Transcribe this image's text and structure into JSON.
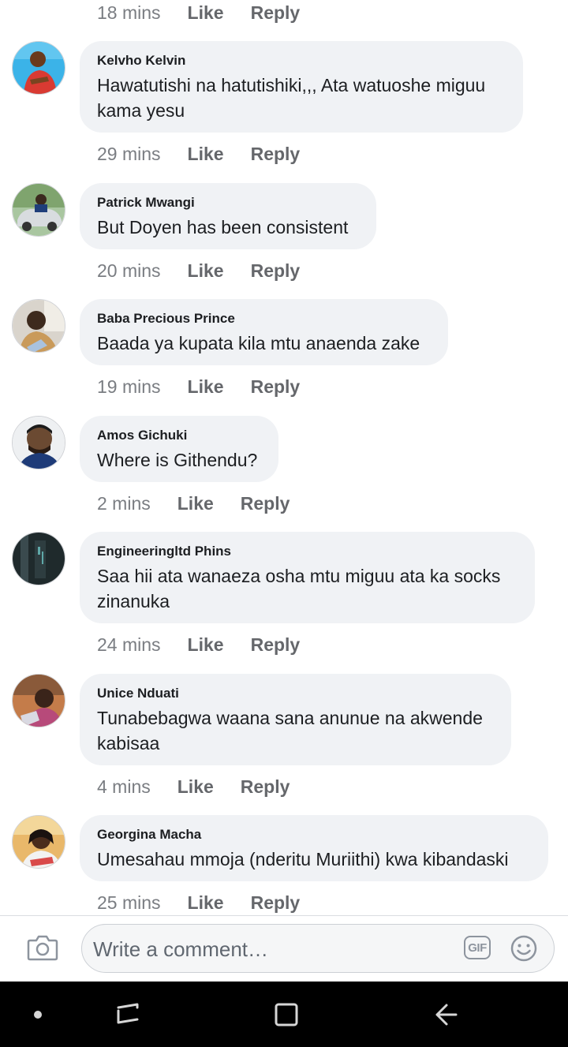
{
  "top_meta": {
    "time": "18 mins",
    "like": "Like",
    "reply": "Reply"
  },
  "comments": [
    {
      "author": "Kelvho Kelvin",
      "text": "Hawatutishi na hatutishiki,,, Ata watuoshe miguu kama yesu",
      "time": "29 mins",
      "like": "Like",
      "reply": "Reply",
      "avatar": "avatar-photo-red-shirt"
    },
    {
      "author": "Patrick Mwangi",
      "text": "But Doyen has been consistent",
      "time": "20 mins",
      "like": "Like",
      "reply": "Reply",
      "avatar": "avatar-photo-car"
    },
    {
      "author": "Baba Precious Prince",
      "text": "Baada ya kupata kila mtu anaenda zake",
      "time": "19 mins",
      "like": "Like",
      "reply": "Reply",
      "avatar": "avatar-photo-man"
    },
    {
      "author": "Amos Gichuki",
      "text": "Where is Githendu?",
      "time": "2 mins",
      "like": "Like",
      "reply": "Reply",
      "avatar": "avatar-photo-man-blue"
    },
    {
      "author": "Engineeringltd Phins",
      "text": "Saa hii ata wanaeza osha mtu miguu ata ka socks zinanuka",
      "time": "24 mins",
      "like": "Like",
      "reply": "Reply",
      "avatar": "avatar-photo-dark"
    },
    {
      "author": "Unice Nduati",
      "text": "Tunabebagwa waana sana anunue na akwende kabisaa",
      "time": "4 mins",
      "like": "Like",
      "reply": "Reply",
      "avatar": "avatar-photo-woman"
    },
    {
      "author": "Georgina Macha",
      "text": "Umesahau mmoja (nderitu Muriithi) kwa kibandaski",
      "time": "25 mins",
      "like": "Like",
      "reply": "Reply",
      "avatar": "avatar-photo-woman-2"
    }
  ],
  "composer": {
    "placeholder": "Write a comment…",
    "gif_label": "GIF",
    "camera_icon": "camera-icon",
    "emoji_icon": "smiley-icon"
  },
  "colors": {
    "bubble": "#f0f2f5",
    "meta_text": "#65676b",
    "navbar": "#000000"
  }
}
